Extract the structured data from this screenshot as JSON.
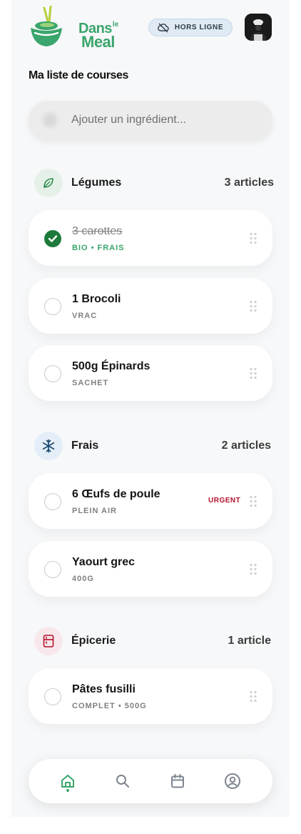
{
  "brand": {
    "name_part1": "Dans",
    "name_part2": "le",
    "name_part3": "Meal",
    "color": "#3aa56c"
  },
  "header": {
    "offline_label": "HORS LIGNE"
  },
  "page": {
    "title": "Ma liste de courses"
  },
  "search": {
    "placeholder": "Ajouter un ingrédient..."
  },
  "categories": [
    {
      "name": "Légumes",
      "count": "3 articles",
      "icon": "leaf-icon",
      "items": [
        {
          "name": "3 carottes",
          "detail": "BIO • FRAIS",
          "checked": true
        },
        {
          "name": "1 Brocoli",
          "detail": "VRAC",
          "checked": false
        },
        {
          "name": "500g Épinards",
          "detail": "SACHET",
          "checked": false
        }
      ]
    },
    {
      "name": "Frais",
      "count": "2 articles",
      "icon": "snowflake-icon",
      "items": [
        {
          "name": "6 Œufs de poule",
          "detail": "PLEIN AIR",
          "checked": false,
          "tag": "URGENT"
        },
        {
          "name": "Yaourt grec",
          "detail": "400G",
          "checked": false
        }
      ]
    },
    {
      "name": "Épicerie",
      "count": "1 article",
      "icon": "pantry-icon",
      "items": [
        {
          "name": "Pâtes fusilli",
          "detail": "COMPLET • 500G",
          "checked": false
        }
      ]
    }
  ],
  "nav": {
    "items": [
      "home-icon",
      "search-icon",
      "calendar-icon",
      "profile-icon"
    ],
    "active": "home-icon"
  },
  "colors": {
    "accent": "#3aa56c",
    "check": "#1d7a3b",
    "urgent": "#b5122c",
    "offline_bg": "#dfeaf5"
  }
}
